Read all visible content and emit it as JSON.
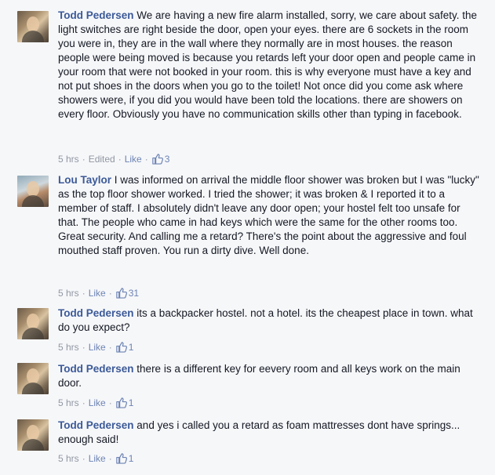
{
  "comments": [
    {
      "author": "Todd Pedersen",
      "text": "We are having a new fire alarm installed, sorry, we care about safety. the light switches are right beside the door, open your eyes. there are 6 sockets in the room you were in, they are in the wall where they normally are in most houses. the reason people were being moved is because you retards left your door open and people came in your room that were not booked in your room. this is why everyone must have a key and not put shoes in the doors when you go to the toilet! Not once did you come ask where showers were, if you did you would have been told the locations. there are showers on every floor. Obviously you have no communication skills other than typing in facebook.",
      "time": "5 hrs",
      "edited": "Edited",
      "like_label": "Like",
      "likes": "3"
    },
    {
      "author": "Lou Taylor",
      "text": "I was informed on arrival the middle floor shower was broken but I was \"lucky\" as the top floor shower worked. I tried the shower; it was broken & I reported it to a member of staff. I absolutely didn't leave any door open; your hostel felt too unsafe for that. The people who came in had keys which were the same for the other rooms too. Great security. And calling me a retard? There's the point about the aggressive and foul mouthed staff proven. You run a dirty dive. Well done.",
      "time": "5 hrs",
      "like_label": "Like",
      "likes": "31"
    },
    {
      "author": "Todd Pedersen",
      "text": "its a backpacker hostel. not a hotel. its the cheapest place in town. what do you expect?",
      "time": "5 hrs",
      "like_label": "Like",
      "likes": "1"
    },
    {
      "author": "Todd Pedersen",
      "text": "there is a different key for eevery room and all keys work on the main door.",
      "time": "5 hrs",
      "like_label": "Like",
      "likes": "1"
    },
    {
      "author": "Todd Pedersen",
      "text": "and yes i called you a retard as foam mattresses dont have springs... enough said!",
      "time": "5 hrs",
      "like_label": "Like",
      "likes": "1"
    }
  ],
  "separator": "·",
  "colors": {
    "author": "#3b5998",
    "meta": "#9197a3",
    "link": "#6d84b4",
    "background": "#f6f7f9"
  },
  "icons": {
    "like": "thumbs-up-icon",
    "avatar": "profile-photo"
  }
}
